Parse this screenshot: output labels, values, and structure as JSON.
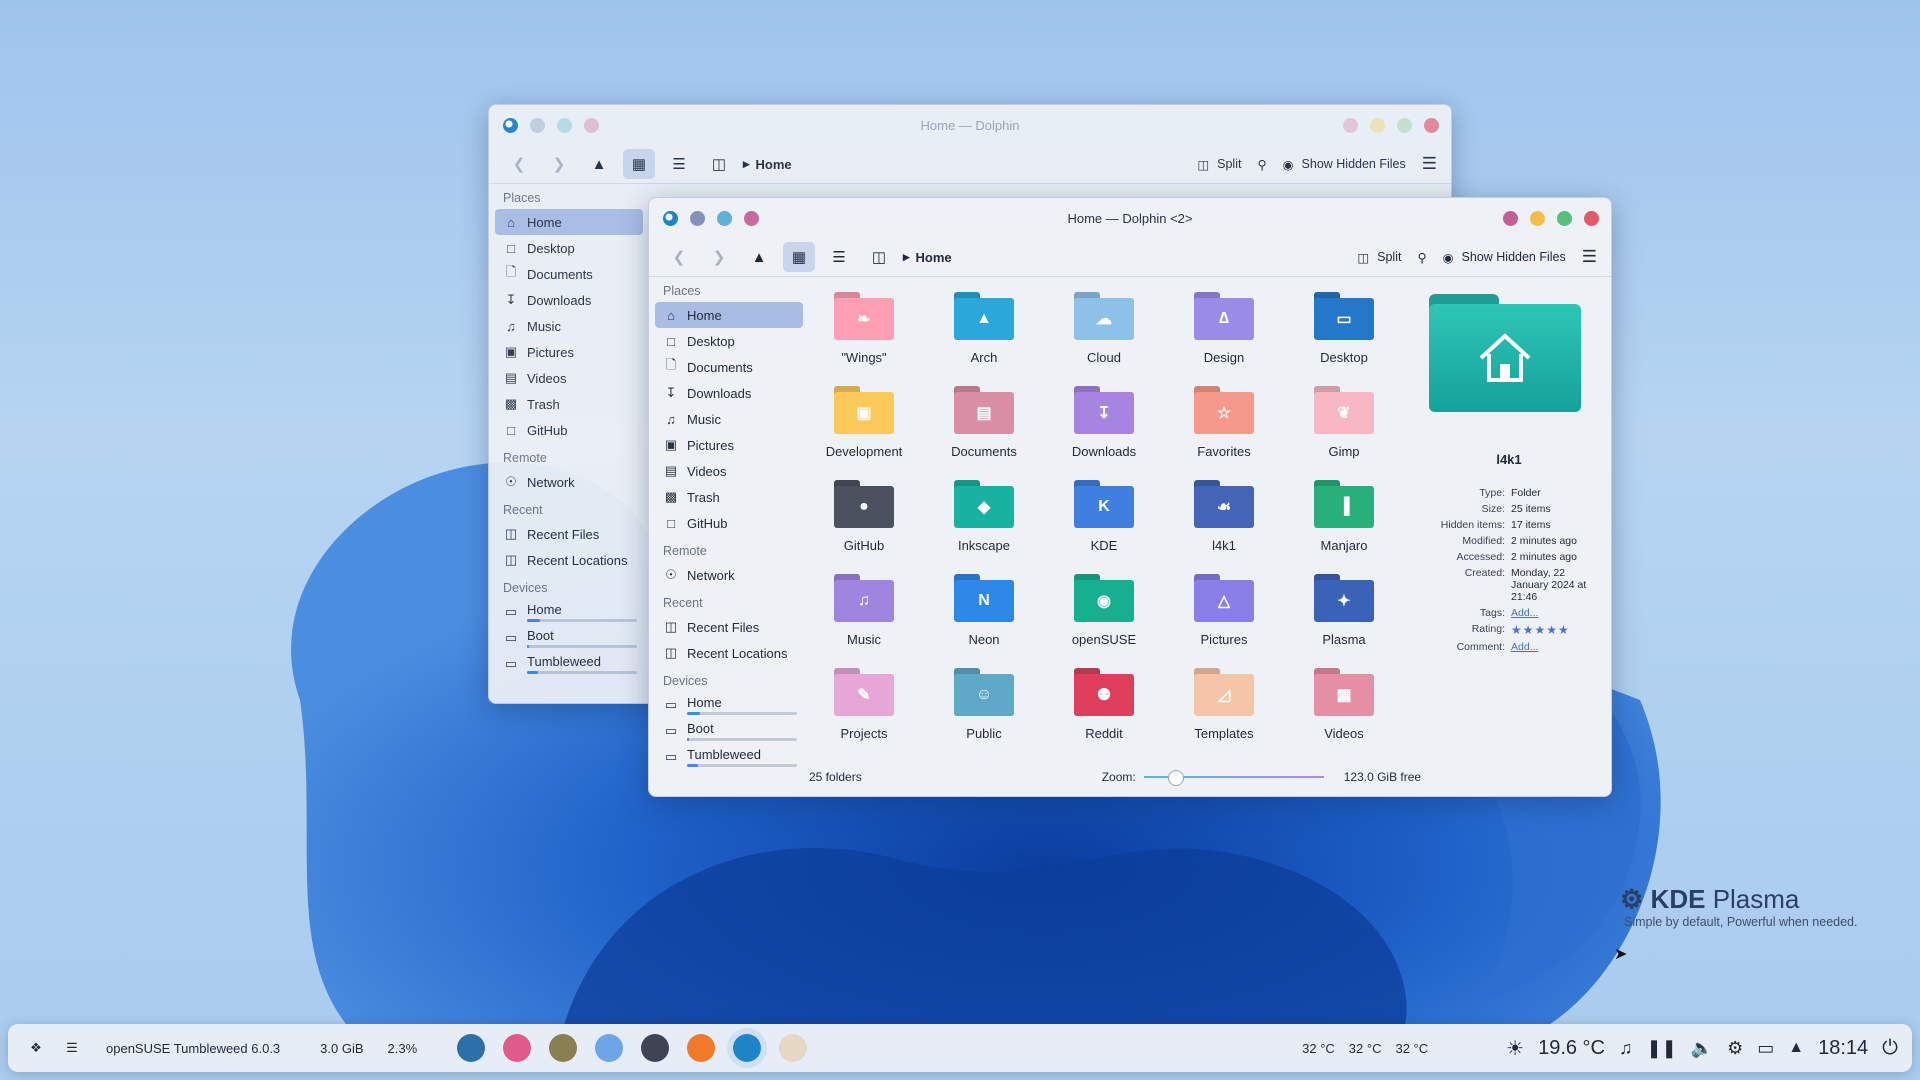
{
  "colors": {
    "accent": "#3d8be6",
    "selection": "#a9bde4",
    "close": "#e05a6a",
    "minimize": "#f2bf4e",
    "maximize": "#58c07a"
  },
  "back_window": {
    "title": "Home — Dolphin",
    "breadcrumb": "Home",
    "split": "Split",
    "show_hidden": "Show Hidden Files"
  },
  "front_window": {
    "title": "Home — Dolphin <2>",
    "breadcrumb": "Home",
    "split": "Split",
    "show_hidden": "Show Hidden Files"
  },
  "places": {
    "places_label": "Places",
    "items": [
      "Home",
      "Desktop",
      "Documents",
      "Downloads",
      "Music",
      "Pictures",
      "Videos",
      "Trash",
      "GitHub"
    ],
    "remote_label": "Remote",
    "remote_items": [
      "Network"
    ],
    "recent_label": "Recent",
    "recent_items": [
      "Recent Files",
      "Recent Locations"
    ],
    "devices_label": "Devices",
    "devices": [
      {
        "name": "Home",
        "usage": 0.12
      },
      {
        "name": "Boot",
        "usage": 0.02
      },
      {
        "name": "Tumbleweed",
        "usage": 0.1
      }
    ]
  },
  "folders": [
    {
      "name": "\"Wings\"",
      "icon": "wings-icon",
      "color": "#ff9fb3"
    },
    {
      "name": "Arch",
      "icon": "arch-icon",
      "color": "#29a8d9"
    },
    {
      "name": "Cloud",
      "icon": "cloud-icon",
      "color": "#8ec1e8"
    },
    {
      "name": "Design",
      "icon": "compass-icon",
      "color": "#9a8be6"
    },
    {
      "name": "Desktop",
      "icon": "desktop-icon",
      "color": "#2578c9"
    },
    {
      "name": "Development",
      "icon": "code-icon",
      "color": "#fbc85a"
    },
    {
      "name": "Documents",
      "icon": "document-icon",
      "color": "#d98ea6"
    },
    {
      "name": "Downloads",
      "icon": "download-icon",
      "color": "#a784e0"
    },
    {
      "name": "Favorites",
      "icon": "star-icon",
      "color": "#f59a8a"
    },
    {
      "name": "Gimp",
      "icon": "gimp-icon",
      "color": "#f7b7c3"
    },
    {
      "name": "GitHub",
      "icon": "github-icon",
      "color": "#4a5260"
    },
    {
      "name": "Inkscape",
      "icon": "inkscape-icon",
      "color": "#19b2a0"
    },
    {
      "name": "KDE",
      "icon": "kde-icon",
      "color": "#3f7fe0"
    },
    {
      "name": "l4k1",
      "icon": "chameleon-icon",
      "color": "#4465b5"
    },
    {
      "name": "Manjaro",
      "icon": "manjaro-icon",
      "color": "#28b07a"
    },
    {
      "name": "Music",
      "icon": "music-icon",
      "color": "#9f85e0"
    },
    {
      "name": "Neon",
      "icon": "neon-icon",
      "color": "#2f87e8"
    },
    {
      "name": "openSUSE",
      "icon": "opensuse-icon",
      "color": "#16b090"
    },
    {
      "name": "Pictures",
      "icon": "picture-icon",
      "color": "#8a7ee8"
    },
    {
      "name": "Plasma",
      "icon": "plasma-icon",
      "color": "#3a63b8"
    },
    {
      "name": "Projects",
      "icon": "brush-icon",
      "color": "#e7a7d6"
    },
    {
      "name": "Public",
      "icon": "people-icon",
      "color": "#5fa8c8"
    },
    {
      "name": "Reddit",
      "icon": "reddit-icon",
      "color": "#df3f5c"
    },
    {
      "name": "Templates",
      "icon": "template-icon",
      "color": "#f6c5a8"
    },
    {
      "name": "Videos",
      "icon": "film-icon",
      "color": "#e48fa3"
    }
  ],
  "info_panel": {
    "name": "l4k1",
    "rows": [
      {
        "k": "Type:",
        "v": "Folder"
      },
      {
        "k": "Size:",
        "v": "25 items"
      },
      {
        "k": "Hidden items:",
        "v": "17 items"
      },
      {
        "k": "Modified:",
        "v": "2 minutes ago"
      },
      {
        "k": "Accessed:",
        "v": "2 minutes ago"
      },
      {
        "k": "Created:",
        "v": "Monday, 22 January 2024 at 21:46"
      }
    ],
    "tags_label": "Tags:",
    "tags_value": "Add...",
    "rating_label": "Rating:",
    "rating": 5,
    "comment_label": "Comment:",
    "comment_value": "Add..."
  },
  "status": {
    "count": "25 folders",
    "zoom_label": "Zoom:",
    "free": "123.0 GiB free",
    "zoom_level": 0.1
  },
  "taskbar": {
    "distro": "openSUSE Tumbleweed 6.0.3",
    "mem": "3.0 GiB",
    "cpu": "2.3%",
    "temps": [
      "32 °C",
      "32 °C",
      "32 °C"
    ],
    "weather": "19.6 °C",
    "clock": "18:14"
  },
  "branding": {
    "kde": "KDE",
    "plasma": "Plasma",
    "tagline": "Simple by default, Powerful when  needed."
  }
}
